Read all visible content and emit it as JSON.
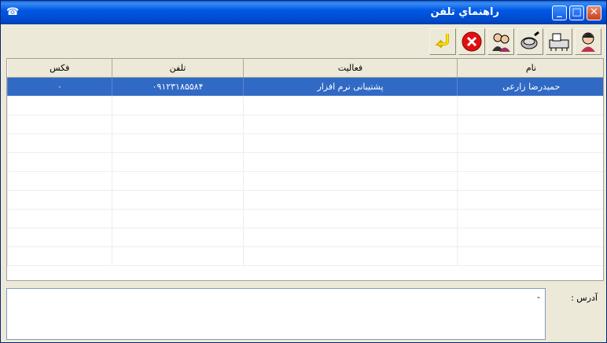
{
  "window": {
    "title": "راهنماي تلفن",
    "app_icon": "app-icon"
  },
  "titlebar_buttons": {
    "minimize": "_",
    "maximize": "□",
    "close": "✕"
  },
  "toolbar": [
    {
      "name": "person-icon"
    },
    {
      "name": "printer-icon"
    },
    {
      "name": "search-icon"
    },
    {
      "name": "group-icon"
    },
    {
      "name": "delete-icon"
    },
    {
      "name": "exit-icon"
    }
  ],
  "table": {
    "columns": [
      "نام",
      "فعاليت",
      "تلفن",
      "فکس"
    ],
    "rows": [
      [
        "حمیدرضا زارعی",
        "پشتیبانی نرم افزار",
        "۰۹۱۲۳۱۸۵۵۸۴",
        "۰"
      ]
    ]
  },
  "address": {
    "label": "آدرس :",
    "value": "-"
  }
}
